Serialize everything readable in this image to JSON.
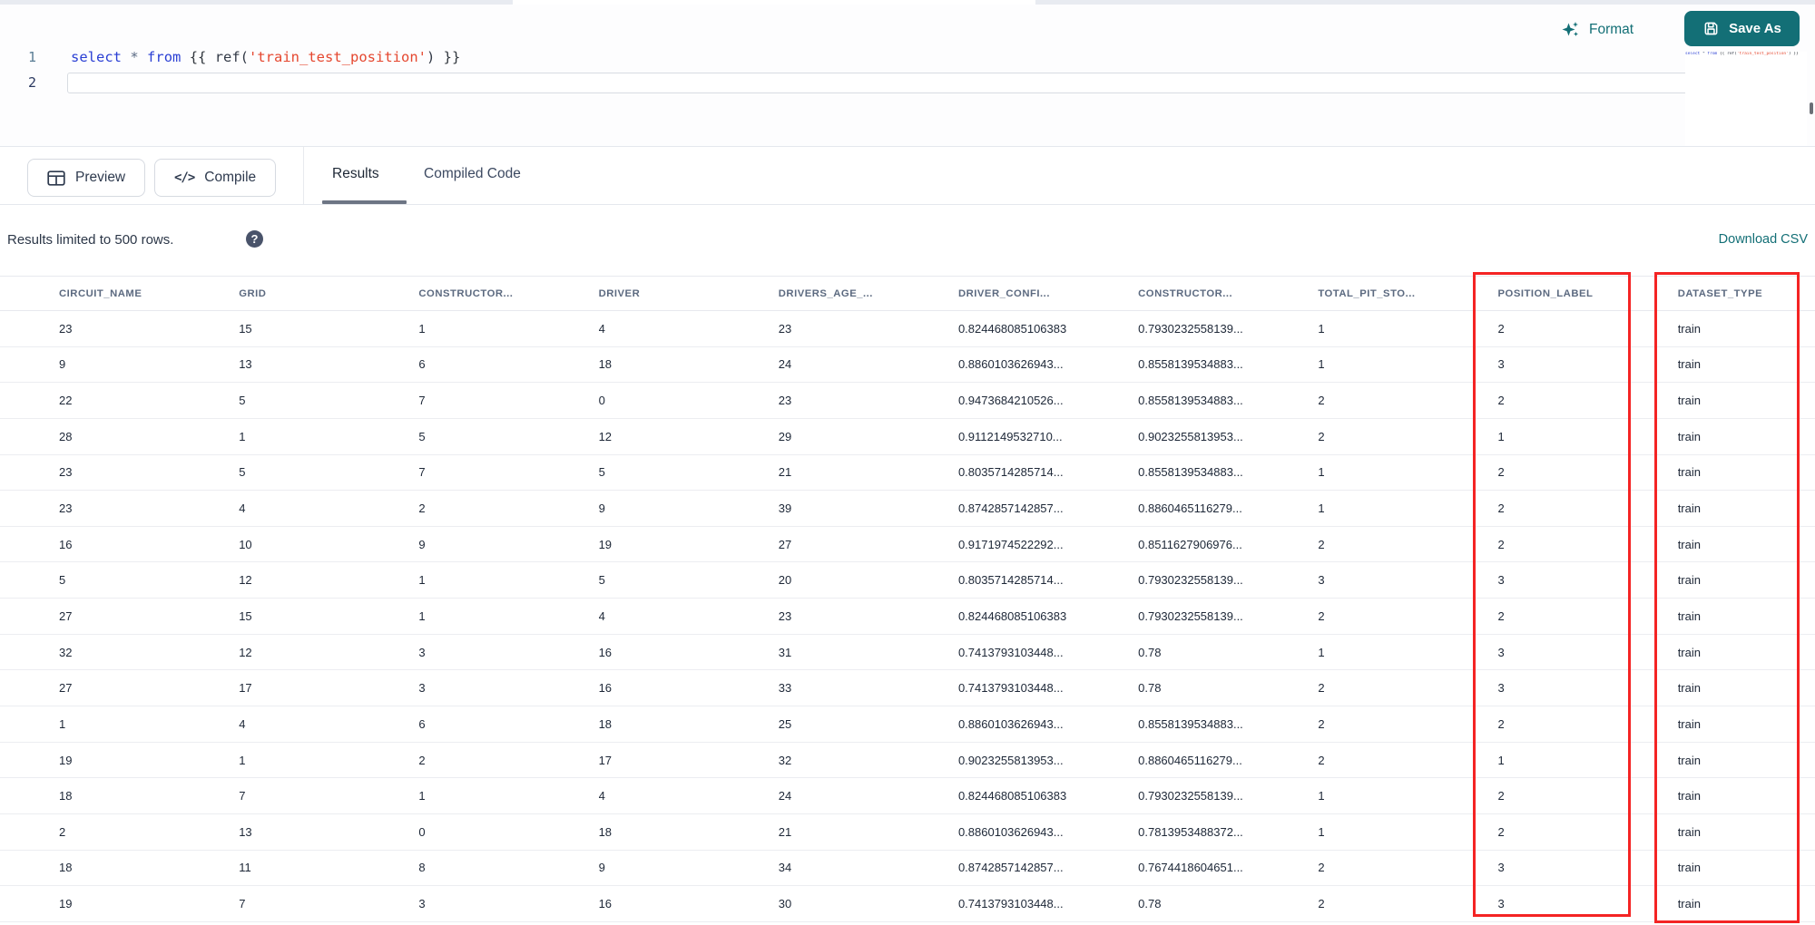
{
  "colors": {
    "accent_teal": "#136f76",
    "highlight_red": "#f42424",
    "syntax": {
      "keyword": "#2a3fd4",
      "operator": "#5b6b84",
      "brace": "#30363d",
      "fn": "#333a47",
      "string": "#e5472f",
      "plain": "#30363d",
      "gutter": "#5a7d95",
      "gutter_active": "#2a3860"
    }
  },
  "editor": {
    "line1": {
      "number": "1",
      "tokens": [
        {
          "text": "select",
          "type": "keyword"
        },
        {
          "text": " ",
          "type": "plain"
        },
        {
          "text": "*",
          "type": "operator"
        },
        {
          "text": " ",
          "type": "plain"
        },
        {
          "text": "from",
          "type": "keyword"
        },
        {
          "text": " {{ ",
          "type": "brace"
        },
        {
          "text": "ref(",
          "type": "fn"
        },
        {
          "text": "'train_test_position'",
          "type": "string"
        },
        {
          "text": ")",
          "type": "fn"
        },
        {
          "text": " }}",
          "type": "brace"
        }
      ]
    },
    "line2": {
      "number": "2"
    }
  },
  "header_actions": {
    "format": "Format",
    "save_as": "Save As"
  },
  "toolbar": {
    "preview": "Preview",
    "compile": "Compile"
  },
  "tabs": [
    {
      "label": "Results",
      "active": true
    },
    {
      "label": "Compiled Code",
      "active": false
    }
  ],
  "results_bar": {
    "limit_text": "Results limited to 500 rows.",
    "help_glyph": "?",
    "download": "Download CSV"
  },
  "table": {
    "columns": [
      "CIRCUIT_NAME",
      "GRID",
      "CONSTRUCTOR...",
      "DRIVER",
      "DRIVERS_AGE_...",
      "DRIVER_CONFI...",
      "CONSTRUCTOR...",
      "TOTAL_PIT_STO...",
      "POSITION_LABEL",
      "DATASET_TYPE"
    ],
    "highlighted_columns": [
      "POSITION_LABEL",
      "DATASET_TYPE"
    ],
    "rows": [
      [
        "23",
        "15",
        "1",
        "4",
        "23",
        "0.824468085106383",
        "0.7930232558139...",
        "1",
        "2",
        "train"
      ],
      [
        "9",
        "13",
        "6",
        "18",
        "24",
        "0.8860103626943...",
        "0.8558139534883...",
        "1",
        "3",
        "train"
      ],
      [
        "22",
        "5",
        "7",
        "0",
        "23",
        "0.9473684210526...",
        "0.8558139534883...",
        "2",
        "2",
        "train"
      ],
      [
        "28",
        "1",
        "5",
        "12",
        "29",
        "0.9112149532710...",
        "0.9023255813953...",
        "2",
        "1",
        "train"
      ],
      [
        "23",
        "5",
        "7",
        "5",
        "21",
        "0.8035714285714...",
        "0.8558139534883...",
        "1",
        "2",
        "train"
      ],
      [
        "23",
        "4",
        "2",
        "9",
        "39",
        "0.8742857142857...",
        "0.8860465116279...",
        "1",
        "2",
        "train"
      ],
      [
        "16",
        "10",
        "9",
        "19",
        "27",
        "0.9171974522292...",
        "0.8511627906976...",
        "2",
        "2",
        "train"
      ],
      [
        "5",
        "12",
        "1",
        "5",
        "20",
        "0.8035714285714...",
        "0.7930232558139...",
        "3",
        "3",
        "train"
      ],
      [
        "27",
        "15",
        "1",
        "4",
        "23",
        "0.824468085106383",
        "0.7930232558139...",
        "2",
        "2",
        "train"
      ],
      [
        "32",
        "12",
        "3",
        "16",
        "31",
        "0.7413793103448...",
        "0.78",
        "1",
        "3",
        "train"
      ],
      [
        "27",
        "17",
        "3",
        "16",
        "33",
        "0.7413793103448...",
        "0.78",
        "2",
        "3",
        "train"
      ],
      [
        "1",
        "4",
        "6",
        "18",
        "25",
        "0.8860103626943...",
        "0.8558139534883...",
        "2",
        "2",
        "train"
      ],
      [
        "19",
        "1",
        "2",
        "17",
        "32",
        "0.9023255813953...",
        "0.8860465116279...",
        "2",
        "1",
        "train"
      ],
      [
        "18",
        "7",
        "1",
        "4",
        "24",
        "0.824468085106383",
        "0.7930232558139...",
        "1",
        "2",
        "train"
      ],
      [
        "2",
        "13",
        "0",
        "18",
        "21",
        "0.8860103626943...",
        "0.7813953488372...",
        "1",
        "2",
        "train"
      ],
      [
        "18",
        "11",
        "8",
        "9",
        "34",
        "0.8742857142857...",
        "0.7674418604651...",
        "2",
        "3",
        "train"
      ],
      [
        "19",
        "7",
        "3",
        "16",
        "30",
        "0.7413793103448...",
        "0.78",
        "2",
        "3",
        "train"
      ]
    ]
  }
}
